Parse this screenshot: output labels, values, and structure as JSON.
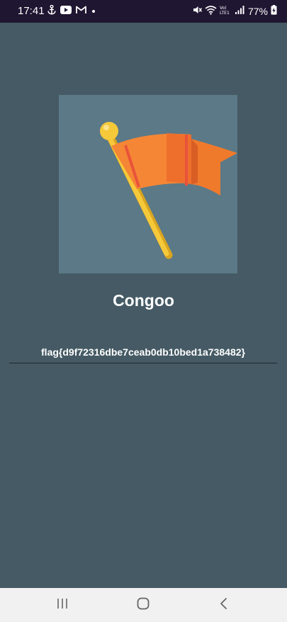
{
  "status_bar": {
    "time": "17:41",
    "battery": "77%",
    "network": "VoLTE1"
  },
  "app": {
    "title": "Congoo",
    "flag_value": "flag{d9f72316dbe7ceab0db10bed1a738482}"
  },
  "nav_bar": {
    "buttons": [
      "recent-apps",
      "home",
      "back"
    ]
  },
  "colors": {
    "status_bar_bg": "#1f1632",
    "app_bg": "#455a64",
    "image_bg": "#5b7987",
    "flag_orange": "#f07a2c",
    "pole_yellow": "#f6c93a",
    "nav_bg": "#f1f1f1"
  }
}
